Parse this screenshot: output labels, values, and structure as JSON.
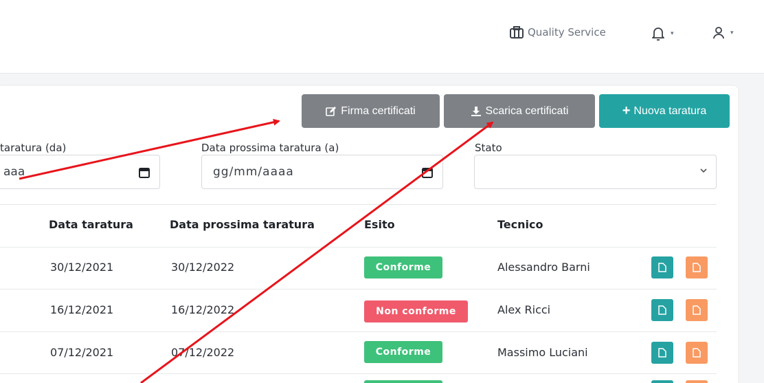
{
  "header": {
    "company": "Quality Service",
    "caret": "▾"
  },
  "toolbar": {
    "sign_label": "Firma certificati",
    "download_label": "Scarica certificati",
    "new_label": "Nuova taratura",
    "new_plus": "+"
  },
  "filters": {
    "date_from_label": "taratura (da)",
    "date_from_value": "aaa",
    "next_date_to_label": "Data prossima taratura (a)",
    "next_date_to_value": "gg/mm/aaaa",
    "status_label": "Stato",
    "status_value": ""
  },
  "table": {
    "headers": {
      "date": "Data taratura",
      "next_date": "Data prossima taratura",
      "outcome": "Esito",
      "technician": "Tecnico"
    },
    "rows": [
      {
        "date": "30/12/2021",
        "next_date": "30/12/2022",
        "outcome": "Conforme",
        "technician": "Alessandro Barni"
      },
      {
        "date": "16/12/2021",
        "next_date": "16/12/2022",
        "outcome": "Non conforme",
        "technician": "Alex Ricci"
      },
      {
        "date": "07/12/2021",
        "next_date": "07/12/2022",
        "outcome": "Conforme",
        "technician": "Massimo Luciani"
      }
    ]
  },
  "colors": {
    "teal": "#23a4a3",
    "gray_button": "#7e8287",
    "conforme": "#3ec17a",
    "non_conforme": "#f05a6b",
    "orange": "#f89a62",
    "annotation_arrow": "#e8141b"
  }
}
